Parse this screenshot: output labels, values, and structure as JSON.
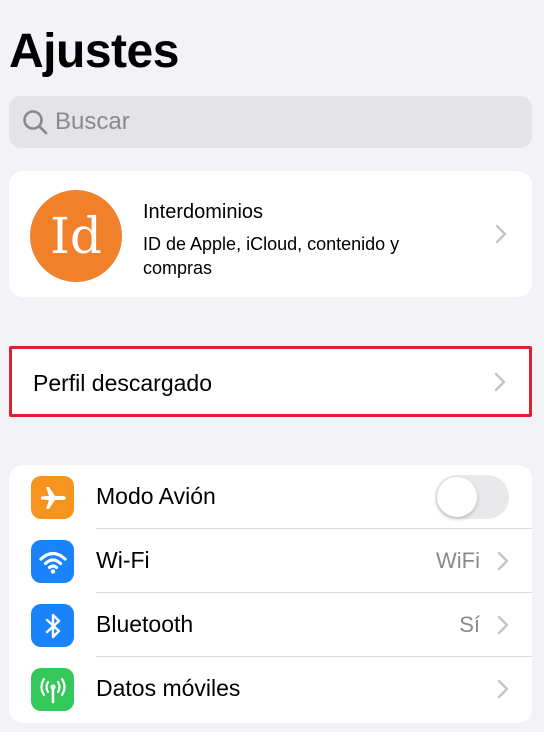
{
  "header": {
    "title": "Ajustes"
  },
  "search": {
    "placeholder": "Buscar",
    "icon": "search-icon"
  },
  "account": {
    "avatar_initials": "Id",
    "avatar_color": "#f0802a",
    "name": "Interdominios",
    "subtitle": "ID de Apple, iCloud, contenido y compras"
  },
  "profile": {
    "label": "Perfil descargado",
    "highlight_color": "#e0202e"
  },
  "settings": {
    "items": [
      {
        "label": "Modo Avión",
        "icon": "airplane-icon",
        "color": "#f7941d",
        "toggle": "off"
      },
      {
        "label": "Wi-Fi",
        "icon": "wifi-icon",
        "color": "#1a82fb",
        "value": "WiFi"
      },
      {
        "label": "Bluetooth",
        "icon": "bluetooth-icon",
        "color": "#1a82fb",
        "value": "Sí"
      },
      {
        "label": "Datos móviles",
        "icon": "antenna-icon",
        "color": "#34c759"
      }
    ]
  }
}
